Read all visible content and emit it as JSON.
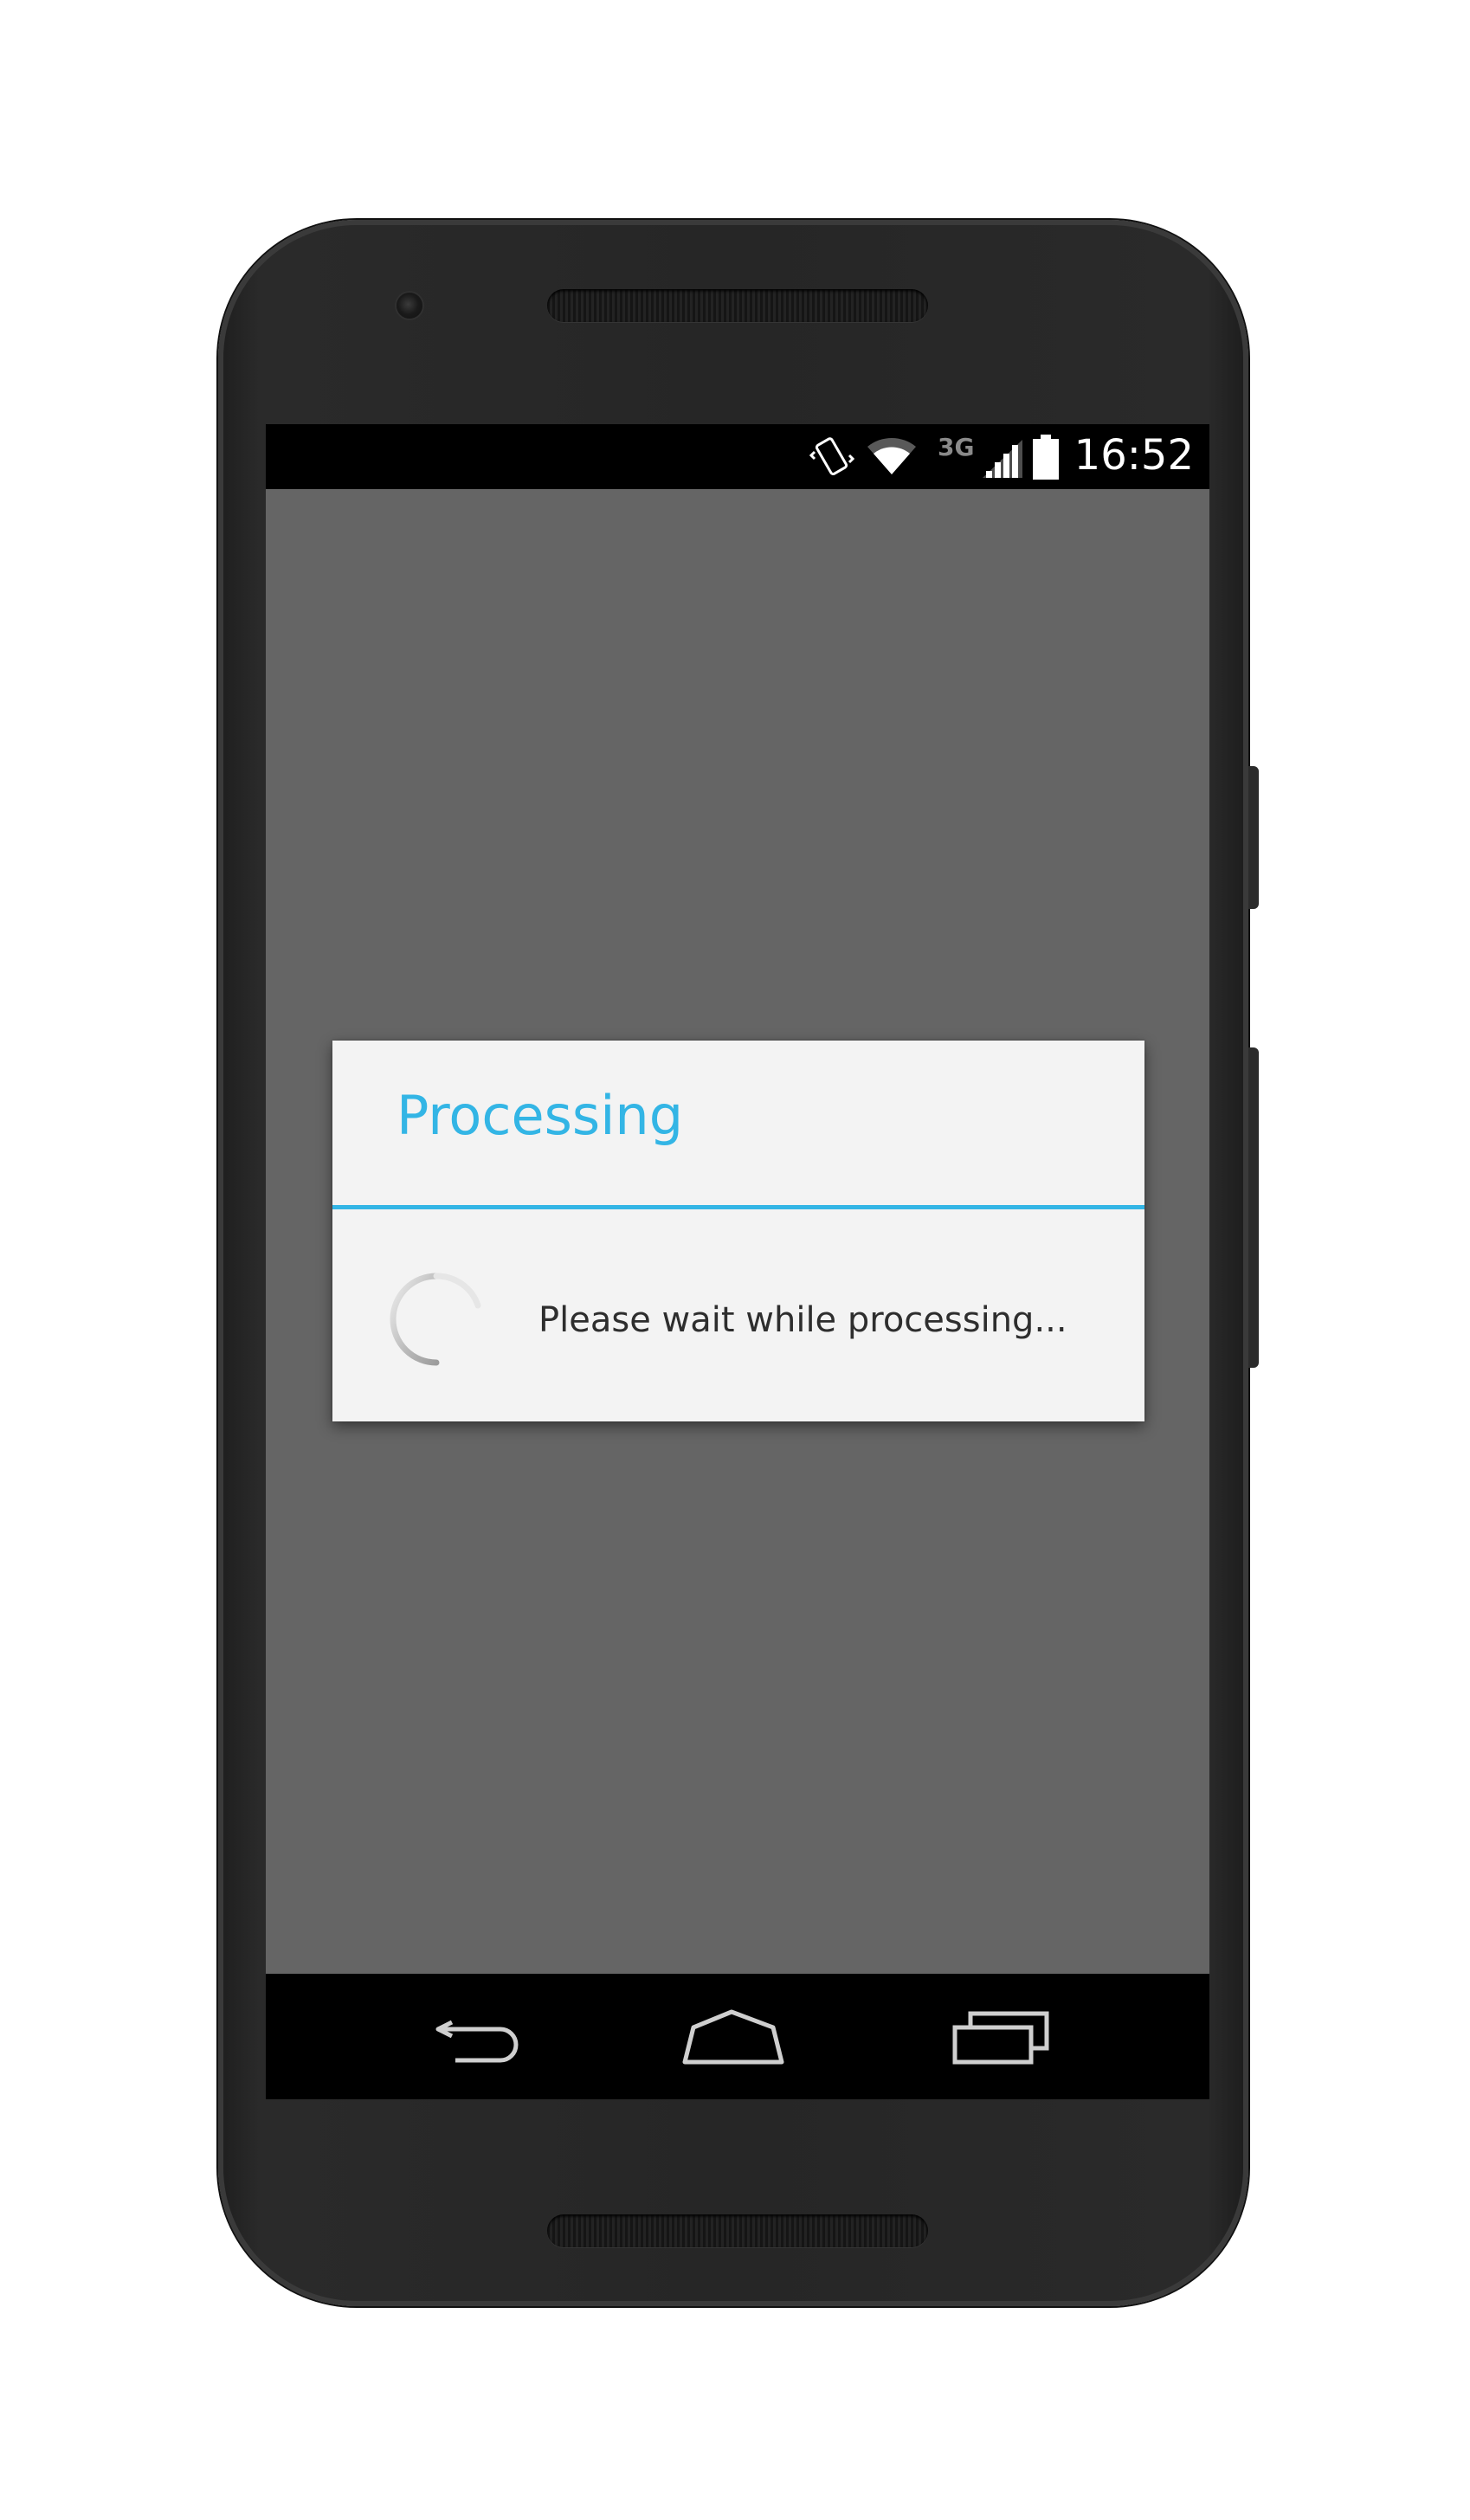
{
  "status_bar": {
    "time": "16:52",
    "network_type": "3G",
    "icons": [
      "vibrate-icon",
      "wifi-icon",
      "signal-icon",
      "battery-icon"
    ]
  },
  "dialog": {
    "title": "Processing",
    "message": "Please wait while processing...",
    "accent_color": "#33b5e5"
  },
  "nav_bar": {
    "buttons": [
      "back-icon",
      "home-icon",
      "recents-icon"
    ]
  },
  "colors": {
    "screen_background": "#656565",
    "dialog_background": "#f3f3f3",
    "bar_background": "#000000"
  }
}
